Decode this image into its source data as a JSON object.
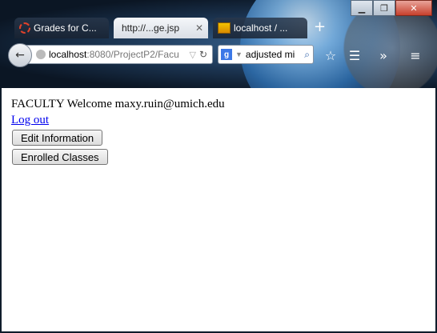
{
  "window": {
    "controls": {
      "minimize": "▁",
      "maximize": "❐",
      "close": "✕"
    }
  },
  "tabs": [
    {
      "label": "Grades for C...",
      "icon": "firefox-dashed-circle-icon",
      "active": false
    },
    {
      "label": "http://...ge.jsp",
      "icon": "",
      "active": true
    },
    {
      "label": "localhost / ...",
      "icon": "phpmyadmin-icon",
      "active": false
    }
  ],
  "new_tab_label": "+",
  "navbar": {
    "back_glyph": "←",
    "url_host": "localhost",
    "url_rest": ":8080/ProjectP2/Facu",
    "search_engine": "g",
    "search_value": "adjusted mi",
    "bookmark_glyph": "☆",
    "reader_glyph": "☰",
    "overflow_glyph": "»",
    "menu_glyph": "≡"
  },
  "page": {
    "role": "FACULTY",
    "welcome": "Welcome",
    "email": "maxy.ruin@umich.edu",
    "logout": "Log out",
    "edit_button": "Edit Information",
    "enrolled_button": "Enrolled Classes"
  }
}
